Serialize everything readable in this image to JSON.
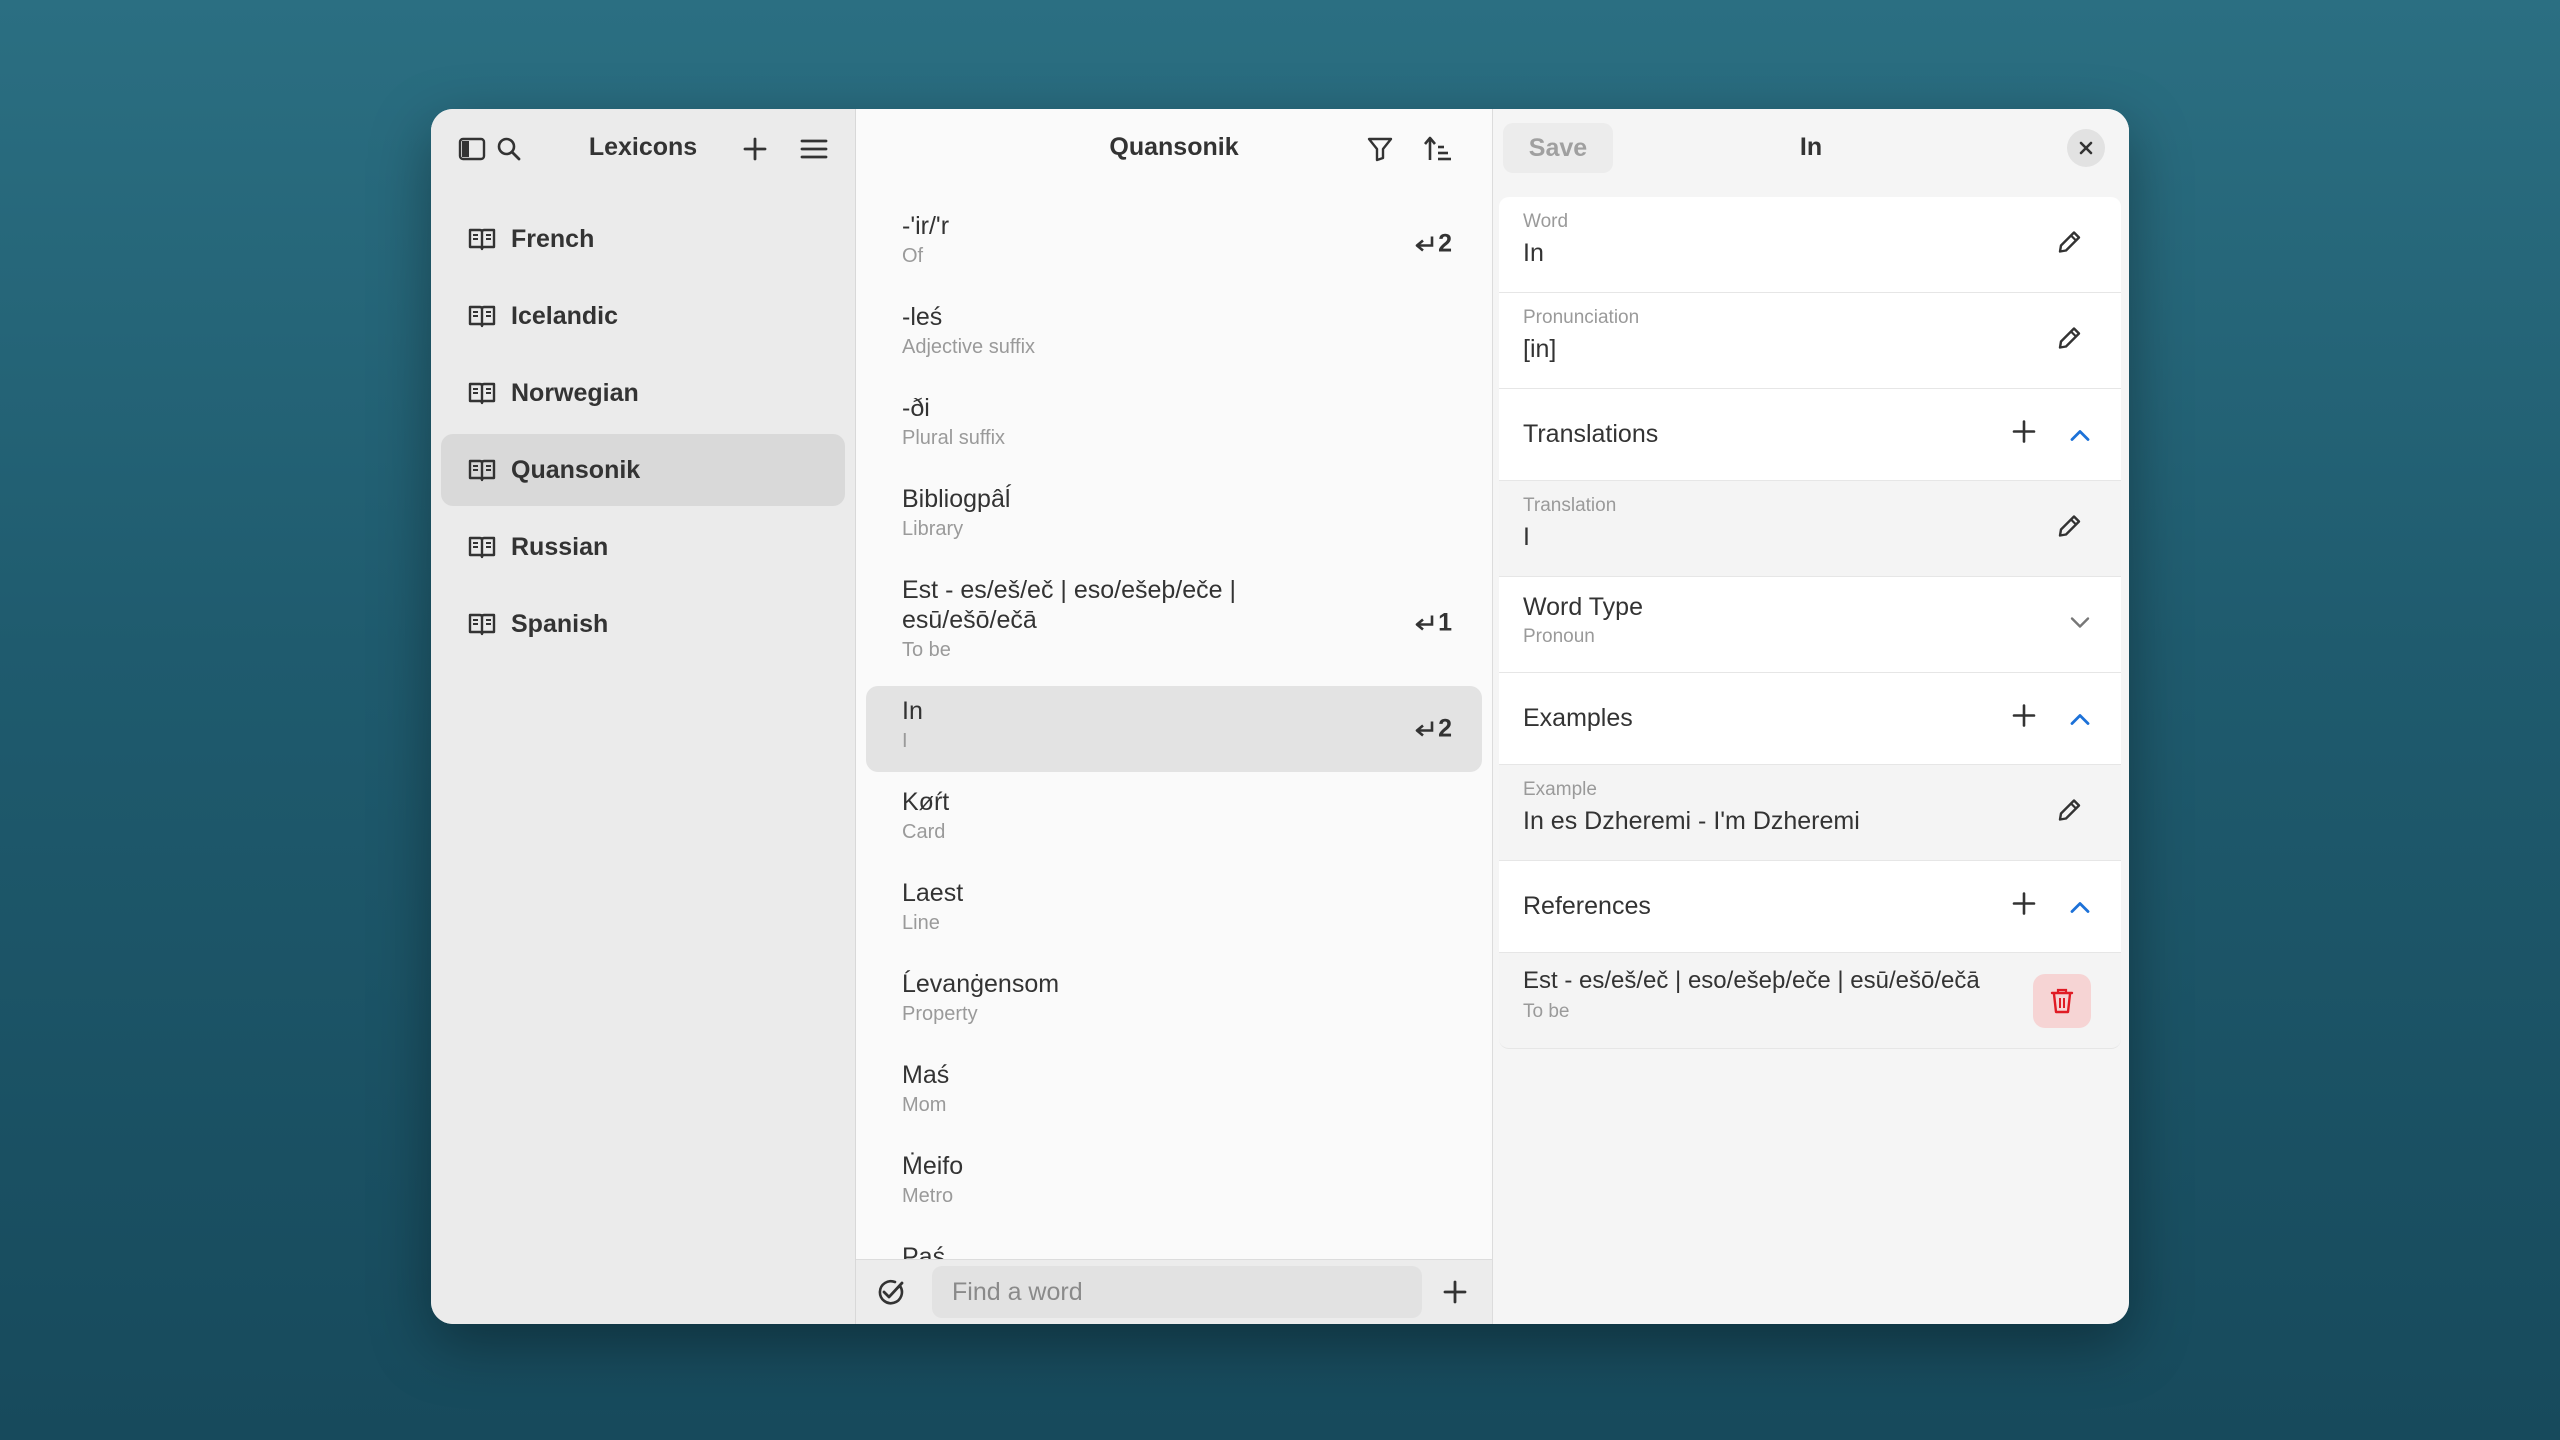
{
  "sidebar": {
    "title": "Lexicons",
    "items": [
      {
        "label": "French"
      },
      {
        "label": "Icelandic"
      },
      {
        "label": "Norwegian"
      },
      {
        "label": "Quansonik"
      },
      {
        "label": "Russian"
      },
      {
        "label": "Spanish"
      }
    ],
    "active_index": 3
  },
  "list": {
    "title": "Quansonik",
    "words": [
      {
        "word": "-'ir/'r",
        "translation": "Of",
        "refs": "2"
      },
      {
        "word": "-leś",
        "translation": "Adjective suffix",
        "refs": ""
      },
      {
        "word": "-ði",
        "translation": "Plural suffix",
        "refs": ""
      },
      {
        "word": "Bibliogpâĺ",
        "translation": "Library",
        "refs": ""
      },
      {
        "word": "Est - es/eš/eč | eso/ešeþ/eče | esū/ešō/ečā",
        "translation": "To be",
        "refs": "1"
      },
      {
        "word": "In",
        "translation": "I",
        "refs": "2"
      },
      {
        "word": "Køŕt",
        "translation": "Card",
        "refs": ""
      },
      {
        "word": "Laest",
        "translation": "Line",
        "refs": ""
      },
      {
        "word": "Ĺevanġensom",
        "translation": "Property",
        "refs": ""
      },
      {
        "word": "Maś",
        "translation": "Mom",
        "refs": ""
      },
      {
        "word": "Ṁeifo",
        "translation": "Metro",
        "refs": ""
      },
      {
        "word": "Paś",
        "translation": "",
        "refs": ""
      }
    ],
    "active_index": 5,
    "search_placeholder": "Find a word"
  },
  "detail": {
    "save_label": "Save",
    "title": "In",
    "word_label": "Word",
    "word_value": "In",
    "pron_label": "Pronunciation",
    "pron_value": "[in]",
    "translations_label": "Translations",
    "translation_label": "Translation",
    "translation_value": "I",
    "wordtype_label": "Word Type",
    "wordtype_value": "Pronoun",
    "examples_label": "Examples",
    "example_label": "Example",
    "example_value": "In es Dzheremi - I'm Dzheremi",
    "references_label": "References",
    "reference_word": "Est - es/eš/eč | eso/ešeþ/eče | esū/ešō/ečā",
    "reference_translation": "To be"
  },
  "colors": {
    "accent": "#1c71d8",
    "destructive": "#e01b24",
    "background": "#1f5b6e"
  }
}
